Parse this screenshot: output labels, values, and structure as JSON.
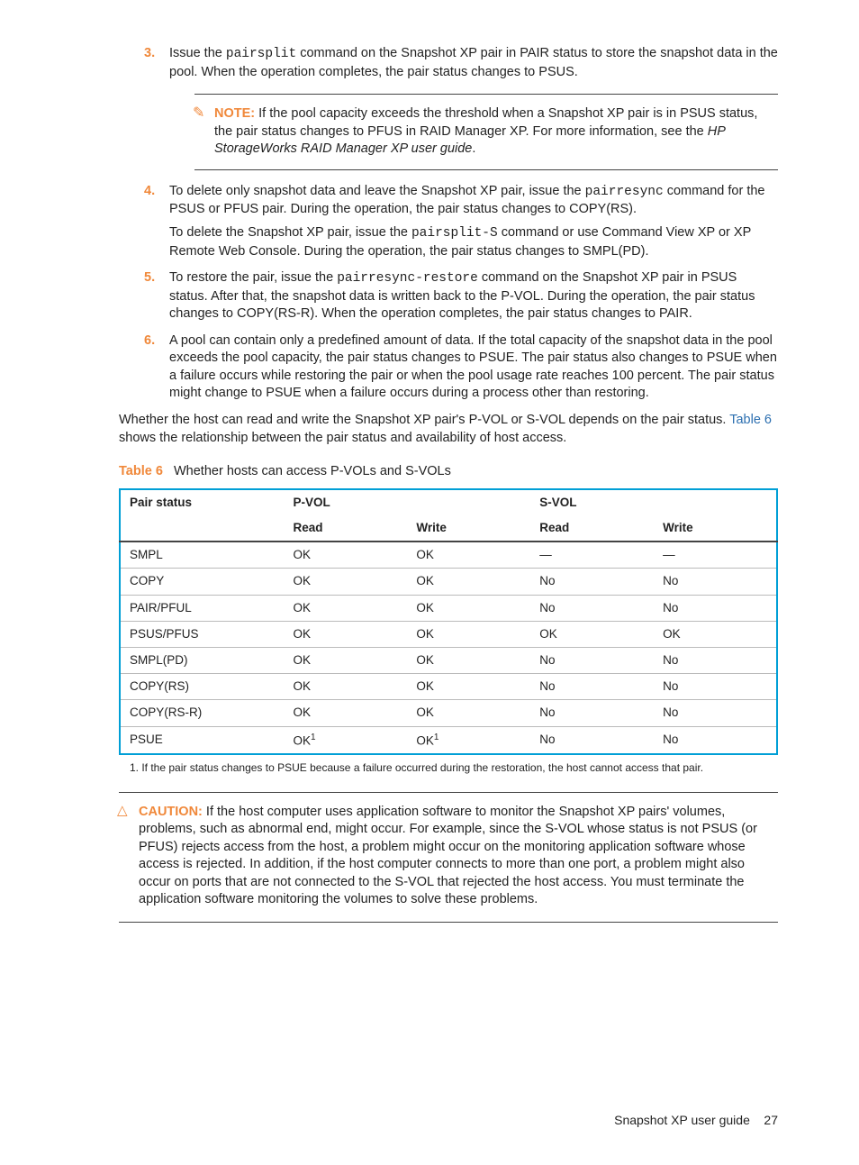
{
  "steps": {
    "s3": {
      "num": "3.",
      "t1": "Issue the ",
      "code1": "pairsplit",
      "t2": " command on the Snapshot XP pair in PAIR status to store the snapshot data in the pool. When the operation completes, the pair status changes to PSUS."
    },
    "note": {
      "label": "NOTE:",
      "t1": "If the pool capacity exceeds the threshold when a Snapshot XP pair is in PSUS status, the pair status changes to PFUS in RAID Manager XP. For more information, see the ",
      "italic": "HP StorageWorks RAID Manager XP user guide",
      "t2": "."
    },
    "s4": {
      "num": "4.",
      "p1a": "To delete only snapshot data and leave the Snapshot XP pair, issue the ",
      "p1code": "pairresync",
      "p1b": " command for the PSUS or PFUS pair. During the operation, the pair status changes to COPY(RS).",
      "p2a": "To delete the Snapshot XP pair, issue the ",
      "p2code": "pairsplit-S",
      "p2b": " command or use Command View XP or XP Remote Web Console. During the operation, the pair status changes to SMPL(PD)."
    },
    "s5": {
      "num": "5.",
      "t1": "To restore the pair, issue the ",
      "code1": "pairresync-restore",
      "t2": " command on the Snapshot XP pair in PSUS status. After that, the snapshot data is written back to the P-VOL. During the operation, the pair status changes to COPY(RS-R). When the operation completes, the pair status changes to PAIR."
    },
    "s6": {
      "num": "6.",
      "text": "A pool can contain only a predefined amount of data. If the total capacity of the snapshot data in the pool exceeds the pool capacity, the pair status changes to PSUE. The pair status also changes to PSUE when a failure occurs while restoring the pair or when the pool usage rate reaches 100 percent. The pair status might change to PSUE when a failure occurs during a process other than restoring."
    }
  },
  "para_after": {
    "t1": "Whether the host can read and write the Snapshot XP pair's P-VOL or S-VOL depends on the pair status. ",
    "link": "Table 6",
    "t2": " shows the relationship between the pair status and availability of host access."
  },
  "table_caption": {
    "label": "Table 6",
    "title": "Whether hosts can access P-VOLs and S-VOLs"
  },
  "table": {
    "head1": [
      "Pair status",
      "P-VOL",
      "S-VOL"
    ],
    "head2": [
      "Read",
      "Write",
      "Read",
      "Write"
    ],
    "rows": [
      [
        "SMPL",
        "OK",
        "OK",
        "—",
        "—"
      ],
      [
        "COPY",
        "OK",
        "OK",
        "No",
        "No"
      ],
      [
        "PAIR/PFUL",
        "OK",
        "OK",
        "No",
        "No"
      ],
      [
        "PSUS/PFUS",
        "OK",
        "OK",
        "OK",
        "OK"
      ],
      [
        "SMPL(PD)",
        "OK",
        "OK",
        "No",
        "No"
      ],
      [
        "COPY(RS)",
        "OK",
        "OK",
        "No",
        "No"
      ],
      [
        "COPY(RS-R)",
        "OK",
        "OK",
        "No",
        "No"
      ]
    ],
    "lastrow": {
      "c0": "PSUE",
      "c1": "OK",
      "sup": "1",
      "c3": "No",
      "c4": "No"
    }
  },
  "footnote": "1.   If the pair status changes to PSUE because a failure occurred during the restoration, the host cannot access that pair.",
  "caution": {
    "label": "CAUTION:",
    "text": "If the host computer uses application software to monitor the Snapshot XP pairs' volumes, problems, such as abnormal end, might occur. For example, since the S-VOL whose status is not PSUS (or PFUS) rejects access from the host, a problem might occur on the monitoring application software whose access is rejected. In addition, if the host computer connects to more than one port, a problem might also occur on ports that are not connected to the S-VOL that rejected the host access. You must terminate the application software monitoring the volumes to solve these problems."
  },
  "footer": {
    "title": "Snapshot XP user guide",
    "page": "27"
  }
}
